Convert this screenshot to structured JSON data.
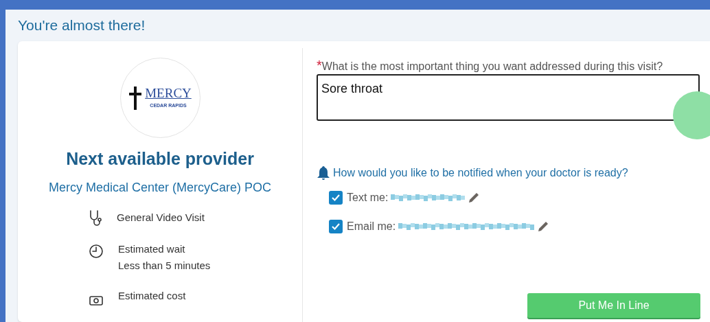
{
  "header": {
    "title": "You're almost there!"
  },
  "provider": {
    "logo": {
      "name": "MERCY",
      "subtitle": "CEDAR RAPIDS"
    },
    "title": "Next available provider",
    "location": "Mercy Medical Center (MercyCare) POC",
    "details": [
      {
        "kind": "visit",
        "lines": [
          "General Video Visit"
        ]
      },
      {
        "kind": "wait",
        "lines": [
          "Estimated wait",
          "Less than 5 minutes"
        ]
      },
      {
        "kind": "cost",
        "lines": [
          "Estimated cost"
        ]
      }
    ]
  },
  "form": {
    "question": {
      "required_mark": "*",
      "label": "What is the most important thing you want addressed during this visit?",
      "value": "Sore throat"
    },
    "notify": {
      "prompt": "How would you like to be notified when your doctor is ready?",
      "options": [
        {
          "label": "Text me:",
          "checked": true
        },
        {
          "label": "Email me:",
          "checked": true
        }
      ]
    },
    "submit": "Put Me In Line"
  }
}
